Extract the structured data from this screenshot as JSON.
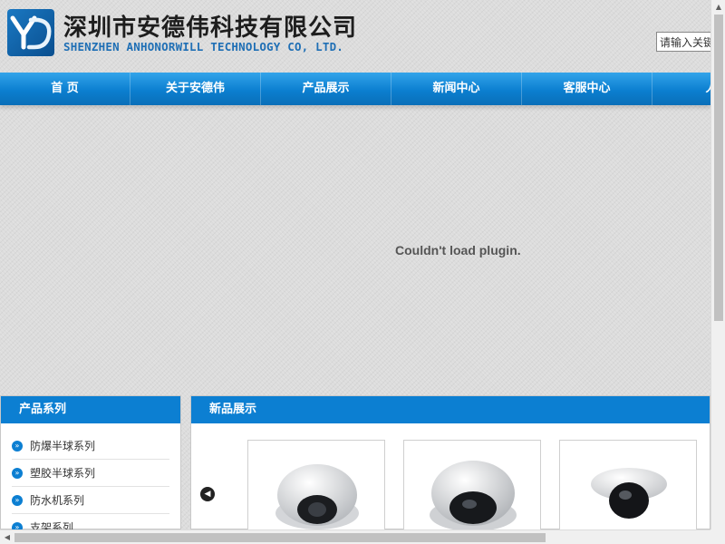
{
  "header": {
    "company_cn": "深圳市安德伟科技有限公司",
    "company_en": "SHENZHEN ANHONORWILL TECHNOLOGY  CO, LTD.",
    "logo_icon": "yd-logo-icon",
    "search_placeholder": "请输入关键"
  },
  "nav": {
    "items": [
      "首 页",
      "关于安德伟",
      "产品展示",
      "新闻中心",
      "客服中心",
      "人才"
    ]
  },
  "plugin": {
    "message": "Couldn't load plugin."
  },
  "left_panel": {
    "title": "产品系列",
    "items": [
      "防爆半球系列",
      "塑胶半球系列",
      "防水机系列",
      "支架系列"
    ]
  },
  "right_panel": {
    "title": "新品展示",
    "prev_icon": "chevron-left-icon"
  },
  "colors": {
    "brand_blue": "#0c7fd2",
    "en_text": "#1f6fb5"
  }
}
